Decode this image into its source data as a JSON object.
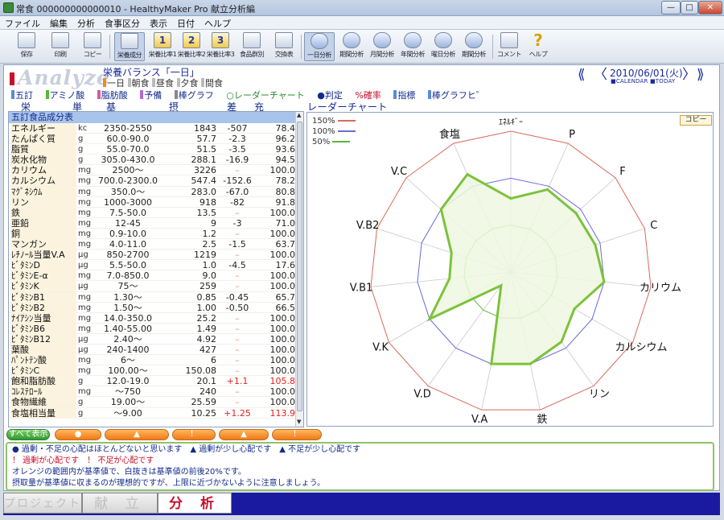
{
  "window": {
    "title": "常食 000000000000010 - HealthyMaker Pro 献立分析編",
    "minimize": "—",
    "maximize": "□",
    "close": "✕"
  },
  "menu": [
    "ファイル",
    "編集",
    "分析",
    "食事区分",
    "表示",
    "日付",
    "ヘルプ"
  ],
  "toolbar": [
    {
      "label": "保存",
      "icon": "save-icon"
    },
    {
      "label": "印刷",
      "icon": "print-icon"
    },
    {
      "label": "コピー",
      "icon": "copy-icon"
    },
    {
      "label": "栄養成分",
      "icon": "nutrition-icon",
      "active": true
    },
    {
      "label": "栄養比率1",
      "icon": "ratio-1-icon",
      "num": "1"
    },
    {
      "label": "栄養比率2",
      "icon": "ratio-2-icon",
      "num": "2"
    },
    {
      "label": "栄養比率3",
      "icon": "ratio-3-icon",
      "num": "3"
    },
    {
      "label": "食品群別",
      "icon": "food-group-icon"
    },
    {
      "label": "交換表",
      "icon": "exchange-icon"
    },
    {
      "label": "一日分析",
      "icon": "day-analysis-icon",
      "active": true
    },
    {
      "label": "期間分析",
      "icon": "period-analysis-icon"
    },
    {
      "label": "月間分析",
      "icon": "month-analysis-icon"
    },
    {
      "label": "年間分析",
      "icon": "year-analysis-icon"
    },
    {
      "label": "曜日分析",
      "icon": "weekday-analysis-icon"
    },
    {
      "label": "期間分析",
      "icon": "period-analysis-2-icon"
    },
    {
      "label": "コメント",
      "icon": "comment-icon"
    },
    {
      "label": "ヘルプ",
      "icon": "help-icon"
    }
  ],
  "header": {
    "title": "Analyze",
    "subtitle": "栄養バランス「一日」",
    "filters": [
      "一日",
      "朝食",
      "昼食",
      "夕食",
      "間食"
    ],
    "date": "2010/06/01(火)",
    "calendar_label": "■CALENDAR ■TODAY"
  },
  "legend": [
    "五訂",
    "アミノ酸",
    "脂肪酸",
    "予備",
    "棒グラフ",
    "レーダーチャート",
    "判定",
    "%確率",
    "指標",
    "棒グラフヒ゜"
  ],
  "columns": [
    "栄 養 素",
    "単位",
    "基 準 値",
    "摂取量",
    "差",
    "充確率(%)",
    "レーダーチャート"
  ],
  "table_caption": "五訂食品成分表",
  "rows": [
    {
      "name": "エネルギー",
      "unit": "kc",
      "std": "2350-2550",
      "amt": "1843",
      "diff": "-507",
      "rate": "78.4"
    },
    {
      "name": "たんぱく質",
      "unit": "g",
      "std": "60.0-90.0",
      "amt": "57.7",
      "diff": "-2.3",
      "rate": "96.2"
    },
    {
      "name": "脂質",
      "unit": "g",
      "std": "55.0-70.0",
      "amt": "51.5",
      "diff": "-3.5",
      "rate": "93.6"
    },
    {
      "name": "炭水化物",
      "unit": "g",
      "std": "305.0-430.0",
      "amt": "288.1",
      "diff": "-16.9",
      "rate": "94.5"
    },
    {
      "name": "カリウム",
      "unit": "mg",
      "std": "2500～",
      "amt": "3226",
      "diff": "–",
      "rate": "100.0"
    },
    {
      "name": "カルシウム",
      "unit": "mg",
      "std": "700.0-2300.0",
      "amt": "547.4",
      "diff": "-152.6",
      "rate": "78.2"
    },
    {
      "name": "ﾏｸﾞﾈｼｳﾑ",
      "unit": "mg",
      "std": "350.0～",
      "amt": "283.0",
      "diff": "-67.0",
      "rate": "80.8"
    },
    {
      "name": "リン",
      "unit": "mg",
      "std": "1000-3000",
      "amt": "918",
      "diff": "-82",
      "rate": "91.8"
    },
    {
      "name": "鉄",
      "unit": "mg",
      "std": "7.5-50.0",
      "amt": "13.5",
      "diff": "–",
      "rate": "100.0"
    },
    {
      "name": "亜鉛",
      "unit": "mg",
      "std": "12-45",
      "amt": "9",
      "diff": "-3",
      "rate": "71.0"
    },
    {
      "name": "銅",
      "unit": "mg",
      "std": "0.9-10.0",
      "amt": "1.2",
      "diff": "–",
      "rate": "100.0"
    },
    {
      "name": "マンガン",
      "unit": "mg",
      "std": "4.0-11.0",
      "amt": "2.5",
      "diff": "-1.5",
      "rate": "63.7"
    },
    {
      "name": "ﾚﾁﾉｰﾙ当量V.A",
      "unit": "μg",
      "std": "850-2700",
      "amt": "1219",
      "diff": "–",
      "rate": "100.0"
    },
    {
      "name": "ﾋﾞﾀﾐﾝD",
      "unit": "μg",
      "std": "5.5-50.0",
      "amt": "1.0",
      "diff": "-4.5",
      "rate": "17.6"
    },
    {
      "name": "ﾋﾞﾀﾐﾝE-α",
      "unit": "mg",
      "std": "7.0-850.0",
      "amt": "9.0",
      "diff": "–",
      "rate": "100.0"
    },
    {
      "name": "ﾋﾞﾀﾐﾝK",
      "unit": "μg",
      "std": "75～",
      "amt": "259",
      "diff": "–",
      "rate": "100.0"
    },
    {
      "name": "ﾋﾞﾀﾐﾝB1",
      "unit": "mg",
      "std": "1.30～",
      "amt": "0.85",
      "diff": "-0.45",
      "rate": "65.7"
    },
    {
      "name": "ﾋﾞﾀﾐﾝB2",
      "unit": "mg",
      "std": "1.50～",
      "amt": "1.00",
      "diff": "-0.50",
      "rate": "66.5"
    },
    {
      "name": "ﾅｲｱｼﾝ当量",
      "unit": "mg",
      "std": "14.0-350.0",
      "amt": "25.2",
      "diff": "–",
      "rate": "100.0"
    },
    {
      "name": "ﾋﾞﾀﾐﾝB6",
      "unit": "mg",
      "std": "1.40-55.00",
      "amt": "1.49",
      "diff": "–",
      "rate": "100.0"
    },
    {
      "name": "ﾋﾞﾀﾐﾝB12",
      "unit": "μg",
      "std": "2.40～",
      "amt": "4.92",
      "diff": "–",
      "rate": "100.0"
    },
    {
      "name": "葉酸",
      "unit": "μg",
      "std": "240-1400",
      "amt": "427",
      "diff": "–",
      "rate": "100.0"
    },
    {
      "name": "ﾊﾟﾝﾄﾃﾝ酸",
      "unit": "mg",
      "std": "6～",
      "amt": "6",
      "diff": "–",
      "rate": "100.0"
    },
    {
      "name": "ﾋﾞﾀﾐﾝC",
      "unit": "mg",
      "std": "100.00～",
      "amt": "150.08",
      "diff": "–",
      "rate": "100.0"
    },
    {
      "name": "飽和脂肪酸",
      "unit": "g",
      "std": "12.0-19.0",
      "amt": "20.1",
      "diff": "+1.1",
      "rate": "105.8",
      "over": true
    },
    {
      "name": "ｺﾚｽﾃﾛｰﾙ",
      "unit": "mg",
      "std": "～750",
      "amt": "240",
      "diff": "–",
      "rate": "100.0"
    },
    {
      "name": "食物繊維",
      "unit": "g",
      "std": "19.00～",
      "amt": "25.59",
      "diff": "–",
      "rate": "100.0"
    },
    {
      "name": "食塩相当量",
      "unit": "g",
      "std": "～9.00",
      "amt": "10.25",
      "diff": "+1.25",
      "rate": "113.9",
      "over": true
    }
  ],
  "radar": {
    "copy_label": "コピー",
    "legend": [
      {
        "label": "150%",
        "color": "#d86a5a"
      },
      {
        "label": "100%",
        "color": "#6a6ad8"
      },
      {
        "label": "50%",
        "color": "#59b63a"
      }
    ],
    "axes": [
      "ｴﾈﾙｷﾞｰ",
      "P",
      "F",
      "C",
      "カリウム",
      "カルシウム",
      "リン",
      "鉄",
      "V.A",
      "V.D",
      "V.K",
      "V.B1",
      "V.B2",
      "V.C",
      "食塩"
    ],
    "values": [
      78.4,
      96.2,
      93.6,
      94.5,
      100.0,
      78.2,
      91.8,
      100.0,
      100.0,
      17.6,
      100.0,
      65.7,
      66.5,
      100.0,
      113.9
    ],
    "max": 150,
    "line_color": "#7cc23a",
    "fill_color": "#eef7e0"
  },
  "buttons": {
    "show_all": "すべて表示",
    "b1": "●",
    "b2": "▲",
    "b3": "！",
    "b4": "▲",
    "b5": "！"
  },
  "notes": [
    "● 過剰・不足の心配はほとんどないと思います　▲ 過剰が少し心配です　▲ 不足が少し心配です",
    "！ 過剰が心配です　！ 不足が心配です",
    "オレンジの範囲内が基準値で、白抜きは基準値の前後20%です。",
    "摂取量が基準値に収まるのが理想的ですが、上限に近づかないように注意しましょう。"
  ],
  "tabs": [
    "プロジェクト",
    "献 立",
    "分 析"
  ]
}
